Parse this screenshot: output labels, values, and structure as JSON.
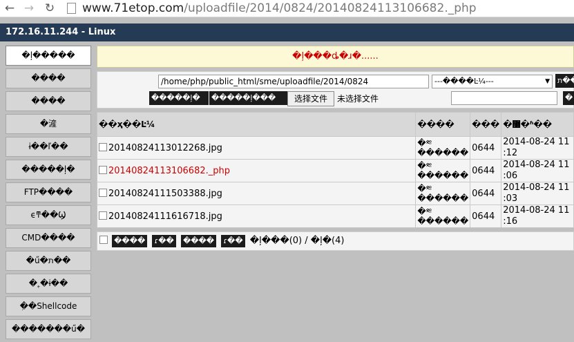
{
  "browser": {
    "url_host": "www.71etop.com",
    "url_path": "/uploadfile/2014/0824/20140824113106682._php"
  },
  "title": "172.16.11.244 - Linux",
  "sidebar": {
    "items": [
      {
        "label": "�ļ�����",
        "active": true
      },
      {
        "label": "����"
      },
      {
        "label": "����"
      },
      {
        "label": "�滻"
      },
      {
        "label": "ɨ��ľ��"
      },
      {
        "label": "�����ļ�"
      },
      {
        "label": "FTP����"
      },
      {
        "label": "ϵͳ��Ϣ"
      },
      {
        "label": "CMD����"
      },
      {
        "label": "�ű�ת��"
      },
      {
        "label": "�˿�ɨ��"
      },
      {
        "label": "ִ��Shellcode"
      },
      {
        "label": "�������ű�"
      }
    ]
  },
  "notice": "�ļ���ȡ�ɹ�......",
  "toolbar": {
    "path_value": "/home/php/public_html/sme/uploadfile/2014/0824",
    "select_value": "---����Ŀ¼---",
    "go_label": "ת��",
    "btn_a_label": "�����ļ�",
    "btn_b_label": "�����ļ���",
    "file_button": "选择文件",
    "file_none": "未选择文件",
    "btn_c_label": "�"
  },
  "table": {
    "headers": [
      "��ҳ��Ŀ¼",
      "����",
      "���",
      "�޸�ʱ��"
    ],
    "rows": [
      {
        "name": "20140824113012268.jpg",
        "actions": "�༭ ������",
        "perm": "0644",
        "date": "2014-08-24 11",
        "time": ":12",
        "highlight": false
      },
      {
        "name": "20140824113106682._php",
        "actions": "�༭ ������",
        "perm": "0644",
        "date": "2014-08-24 11",
        "time": ":06",
        "highlight": true
      },
      {
        "name": "20140824111503388.jpg",
        "actions": "�༭ ������",
        "perm": "0644",
        "date": "2014-08-24 11",
        "time": ":03",
        "highlight": false
      },
      {
        "name": "20140824111616718.jpg",
        "actions": "�༭ ������",
        "perm": "0644",
        "date": "2014-08-24 11",
        "time": ":16",
        "highlight": false
      }
    ]
  },
  "footer": {
    "btn1": "����",
    "btn2": "ɾ��",
    "btn3": "����",
    "btn4": "ɾ��",
    "summary": "�ļ���(0) / �ļ�(4)"
  }
}
